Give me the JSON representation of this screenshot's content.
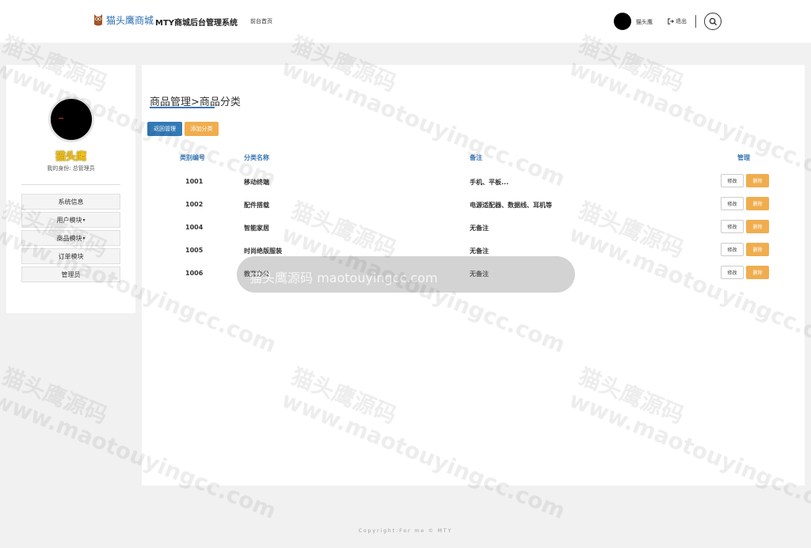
{
  "header": {
    "brand_name": "猫头鹰商城",
    "system_title": "MTY商城后台管理系统",
    "home_link": "前台首页",
    "username": "猫头鹰",
    "logout_label": "退出"
  },
  "sidebar": {
    "profile_name": "猫头鹰",
    "profile_role": "我的身份: 总管理员",
    "menu": [
      {
        "label": "系统信息",
        "has_caret": false
      },
      {
        "label": "用户模块",
        "has_caret": true
      },
      {
        "label": "商品模块",
        "has_caret": true
      },
      {
        "label": "订单模块",
        "has_caret": false
      },
      {
        "label": "管理员",
        "has_caret": false
      }
    ]
  },
  "main": {
    "breadcrumb": "商品管理>商品分类",
    "back_button": "返回管理",
    "add_button": "添加分类",
    "table": {
      "headers": {
        "id": "类别编号",
        "name": "分类名称",
        "note": "备注",
        "actions": "管理"
      },
      "rows": [
        {
          "id": "1001",
          "name": "移动终端",
          "note": "手机、平板..."
        },
        {
          "id": "1002",
          "name": "配件搭载",
          "note": "电源适配器、数据线、耳机等"
        },
        {
          "id": "1004",
          "name": "智能家居",
          "note": "无备注"
        },
        {
          "id": "1005",
          "name": "时尚绝版服装",
          "note": "无备注"
        },
        {
          "id": "1006",
          "name": "教育办公",
          "note": "无备注"
        }
      ],
      "edit_label": "修改",
      "delete_label": "删除"
    }
  },
  "overlay": {
    "banner_text": "猫头鹰源码 maotouyingcc.com",
    "watermark_name": "猫头鹰源码",
    "watermark_url": "www.maotouyingcc.com"
  },
  "footer": {
    "text": "Copyright:For me © MTY"
  },
  "colors": {
    "primary": "#337ab7",
    "warning": "#f0ad4e",
    "header_link": "#3a77b5",
    "name_gold": "#f0c419"
  },
  "icons": {
    "logout": "sign-out-icon",
    "search": "search-icon",
    "brand": "owl-logo-icon"
  }
}
